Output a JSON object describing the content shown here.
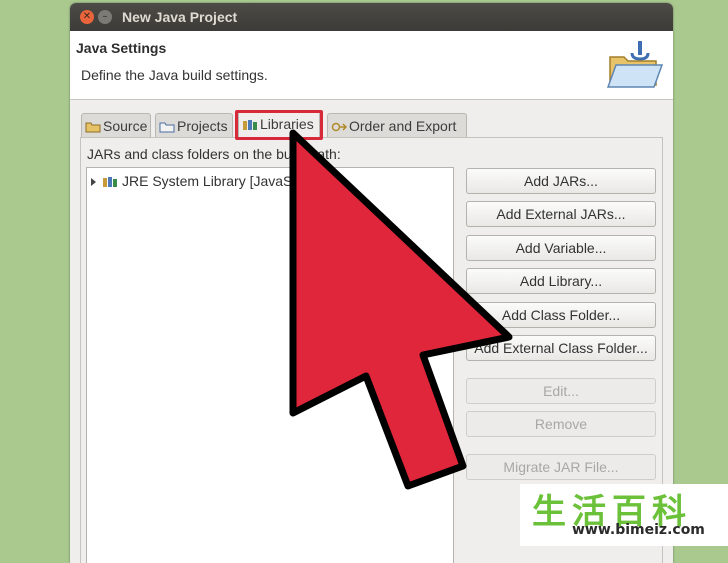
{
  "window": {
    "title": "New Java Project",
    "close_glyph": "✕",
    "minimize_glyph": "–"
  },
  "header": {
    "title": "Java Settings",
    "description": "Define the Java build settings."
  },
  "tabs": [
    {
      "label": "Source",
      "icon": "source-folder-icon",
      "active": false
    },
    {
      "label": "Projects",
      "icon": "projects-icon",
      "active": false
    },
    {
      "label": "Libraries",
      "icon": "libraries-icon",
      "active": true
    },
    {
      "label": "Order and Export",
      "icon": "order-export-icon",
      "active": false
    }
  ],
  "libraries": {
    "path_label": "JARs and class folders on the build path:",
    "tree_items": [
      {
        "label": "JRE System Library [JavaSE-1.8]",
        "icon": "jre-library-icon",
        "expanded": false
      }
    ],
    "buttons": [
      {
        "label": "Add JARs...",
        "enabled": true
      },
      {
        "label": "Add External JARs...",
        "enabled": true
      },
      {
        "label": "Add Variable...",
        "enabled": true
      },
      {
        "label": "Add Library...",
        "enabled": true
      },
      {
        "label": "Add Class Folder...",
        "enabled": true
      },
      {
        "label": "Add External Class Folder...",
        "enabled": true
      },
      {
        "label": "Edit...",
        "enabled": false
      },
      {
        "label": "Remove",
        "enabled": false
      },
      {
        "label": "Migrate JAR File...",
        "enabled": false
      }
    ]
  },
  "overlay": {
    "arrow_color": "#e0263a",
    "highlight_color": "#d8293a"
  },
  "watermark": {
    "chinese": "生活百科",
    "url": "www.bimeiz.com"
  },
  "colors": {
    "background": "#a9c98f",
    "titlebar": "#3c3b37",
    "close_button": "#e9643b"
  }
}
